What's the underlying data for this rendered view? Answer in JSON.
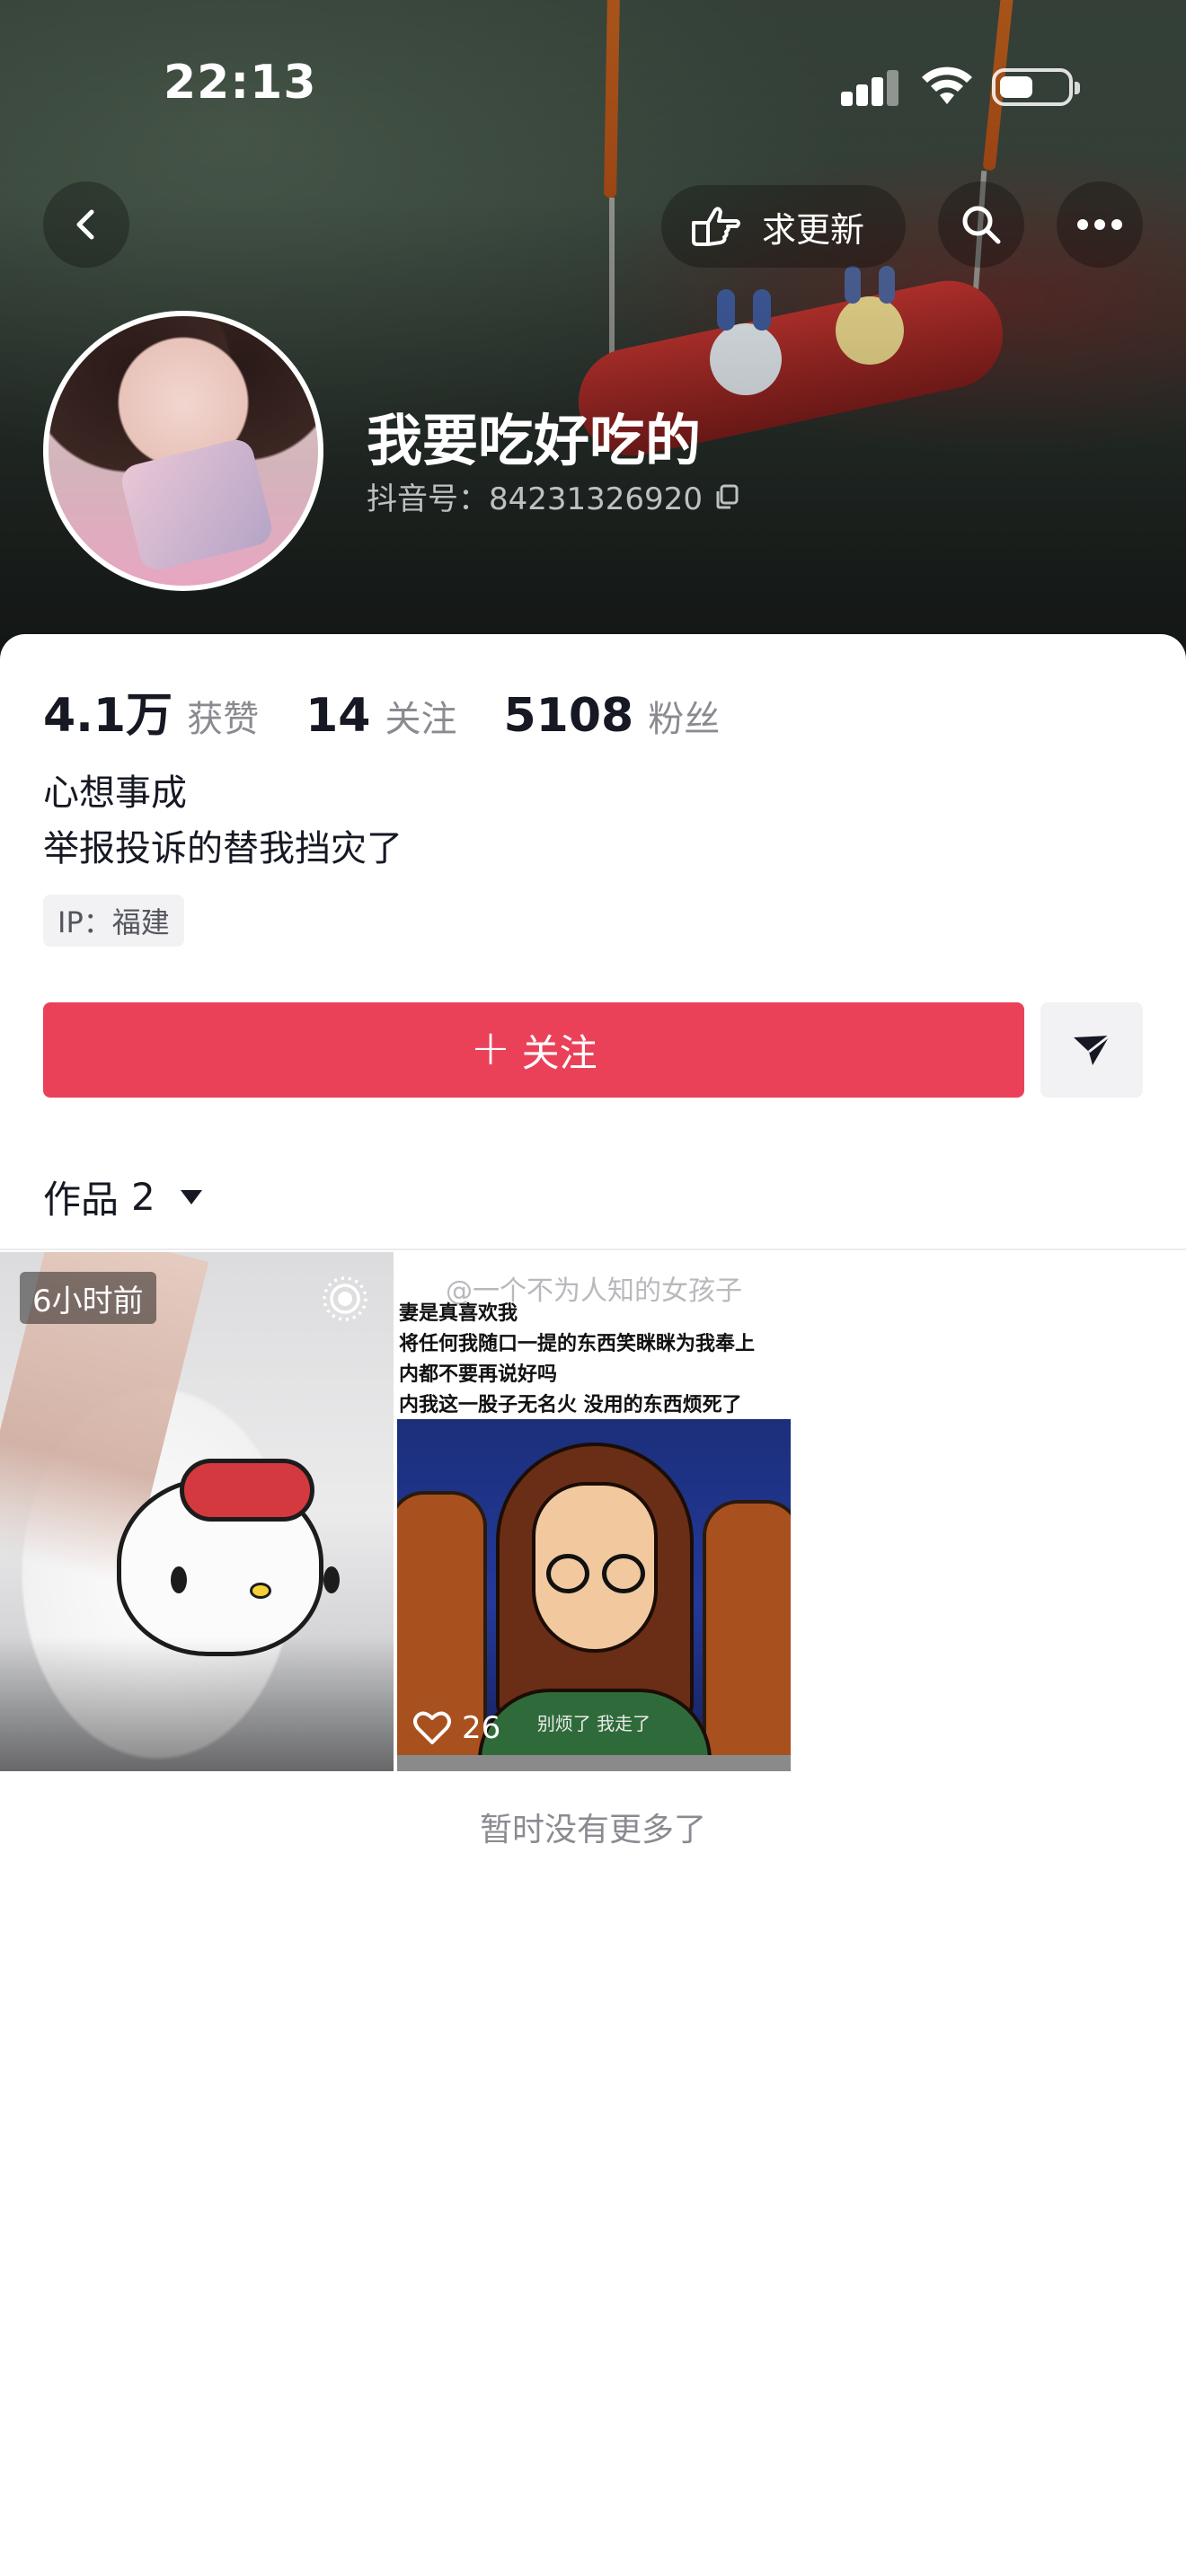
{
  "status_bar": {
    "time": "22:13"
  },
  "nav": {
    "update_label": "求更新"
  },
  "profile": {
    "nickname": "我要吃好吃的",
    "douyin_id": "抖音号：84231326920"
  },
  "stats": [
    {
      "value": "4.1万",
      "label": "获赞"
    },
    {
      "value": "14",
      "label": "关注"
    },
    {
      "value": "5108",
      "label": "粉丝"
    }
  ],
  "bio": {
    "line1": "心想事成",
    "line2": "举报投诉的替我挡灾了"
  },
  "ip_tag": "IP：福建",
  "actions": {
    "follow_label": "关注",
    "follow_prefix": "+"
  },
  "works_tab": {
    "label": "作品",
    "count": "2"
  },
  "videos": [
    {
      "time_badge": "6小时前"
    },
    {
      "watermark": "@一个不为人知的女孩子",
      "caption_lines": [
        "妻是真喜欢我",
        "将任何我随口一提的东西笑眯眯为我奉上",
        "内都不要再说好吗",
        "内我这一股子无名火  没用的东西烦死了"
      ],
      "subtitle": "别烦了 我走了",
      "likes": "26"
    }
  ],
  "footer": {
    "no_more": "暂时没有更多了"
  },
  "colors": {
    "accent": "#ea4159",
    "text_secondary": "#8a8b91"
  },
  "icons": [
    "back-icon",
    "hand-point-icon",
    "search-icon",
    "more-icon",
    "copy-icon",
    "send-icon",
    "live-photo-icon",
    "heart-icon"
  ]
}
